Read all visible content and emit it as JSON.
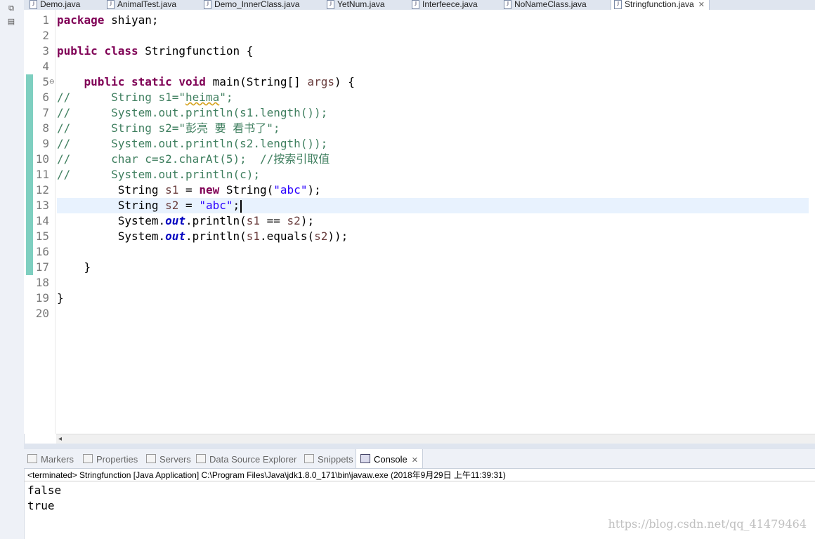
{
  "editor_tabs": [
    {
      "label": "Demo.java"
    },
    {
      "label": "AnimalTest.java"
    },
    {
      "label": "Demo_InnerClass.java"
    },
    {
      "label": "YetNum.java"
    },
    {
      "label": "Interfeece.java"
    },
    {
      "label": "NoNameClass.java"
    },
    {
      "label": "Stringfunction.java",
      "active": true
    }
  ],
  "code": {
    "line_numbers": [
      "1",
      "2",
      "3",
      "4",
      "5",
      "6",
      "7",
      "8",
      "9",
      "10",
      "11",
      "12",
      "13",
      "14",
      "15",
      "16",
      "17",
      "18",
      "19",
      "20"
    ],
    "l1": {
      "kw": "package",
      "rest": " shiyan;"
    },
    "l3": {
      "kw1": "public",
      "kw2": "class",
      "rest": " Stringfunction {"
    },
    "l5": {
      "indent": "    ",
      "kw1": "public",
      "kw2": "static",
      "kw3": "void",
      "t1": " main(String[] ",
      "var": "args",
      "t2": ") {"
    },
    "l6": {
      "cmt_a": "//      String s1=\"",
      "squig": "heima",
      "cmt_b": "\";"
    },
    "l7": "//      System.out.println(s1.length());",
    "l8": "//      String s2=\"彭亮 要 看书了\";",
    "l9": "//      System.out.println(s2.length());",
    "l10": "//      char c=s2.charAt(5);  //按索引取值",
    "l11": "//      System.out.println(c);",
    "l12": {
      "indent": "         ",
      "t1": "String ",
      "var": "s1",
      "t2": " = ",
      "kw": "new",
      "t3": " String(",
      "str": "\"abc\"",
      "t4": ");"
    },
    "l13": {
      "indent": "         ",
      "t1": "String ",
      "var": "s2",
      "t2": " = ",
      "str": "\"abc\"",
      "t3": ";"
    },
    "l14": {
      "indent": "         ",
      "t1": "System.",
      "fld": "out",
      "t2": ".println(",
      "v1": "s1",
      "t3": " == ",
      "v2": "s2",
      "t4": ");"
    },
    "l15": {
      "indent": "         ",
      "t1": "System.",
      "fld": "out",
      "t2": ".println(",
      "v1": "s1",
      "t3": ".equals(",
      "v2": "s2",
      "t4": "));"
    },
    "l17": "    }",
    "l19": "}"
  },
  "views": {
    "tabs": [
      "Markers",
      "Properties",
      "Servers",
      "Data Source Explorer",
      "Snippets",
      "Console"
    ],
    "active": "Console"
  },
  "console": {
    "info": "<terminated> Stringfunction [Java Application] C:\\Program Files\\Java\\jdk1.8.0_171\\bin\\javaw.exe (2018年9月29日 上午11:39:31)",
    "output": [
      "false",
      "true"
    ]
  },
  "watermark": "https://blog.csdn.net/qq_41479464",
  "colors": {
    "keyword": "#7f0055",
    "string": "#2a00ff",
    "comment": "#3f7f5f",
    "field": "#0000c0",
    "current_line": "#e8f2fe"
  }
}
